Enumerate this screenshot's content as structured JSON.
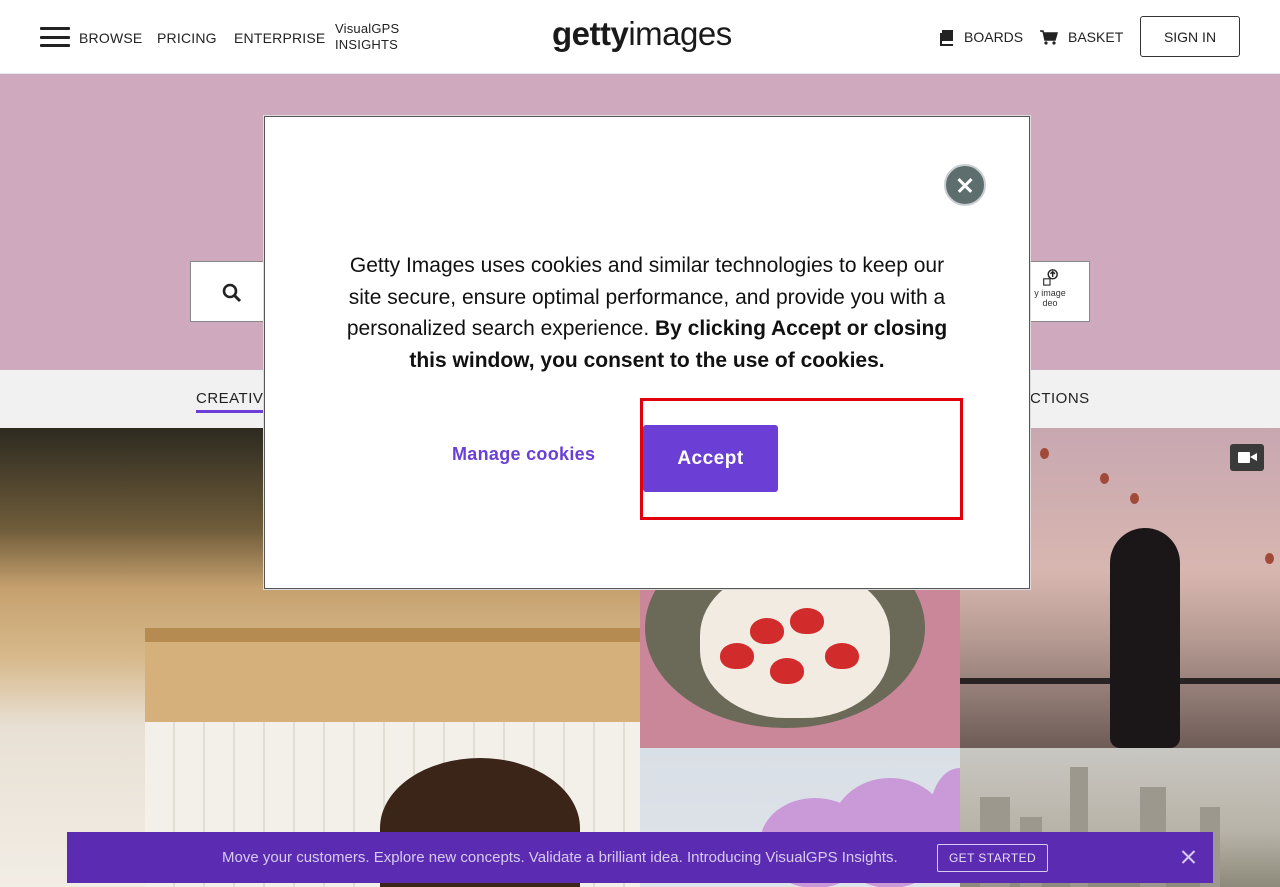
{
  "header": {
    "nav": {
      "browse": "BROWSE",
      "pricing": "PRICING",
      "enterprise": "ENTERPRISE",
      "visualgps_line1": "VisualGPS",
      "visualgps_line2": "INSIGHTS"
    },
    "logo_bold": "getty",
    "logo_light": "images",
    "boards": "BOARDS",
    "basket": "BASKET",
    "sign_in": "SIGN IN"
  },
  "search": {
    "by_image_line1": "y image",
    "by_image_line2": "deo"
  },
  "tabs": {
    "creative": "CREATIV",
    "collections": "CTIONS"
  },
  "cookie_dialog": {
    "text_regular": "Getty Images uses cookies and similar technologies to keep our site secure, ensure optimal performance, and provide you with a personalized search experience. ",
    "text_bold": "By clicking Accept or closing this window, you consent to the use of cookies.",
    "manage_label": "Manage cookies",
    "accept_label": "Accept"
  },
  "promo": {
    "text": "Move your customers. Explore new concepts. Validate a brilliant idea. Introducing VisualGPS Insights.",
    "cta": "GET STARTED"
  },
  "colors": {
    "brand_purple": "#6b3fd6",
    "promo_purple": "#5b2bb2",
    "hero_pink": "#cfa9bd",
    "highlight_red": "#e2000d"
  }
}
